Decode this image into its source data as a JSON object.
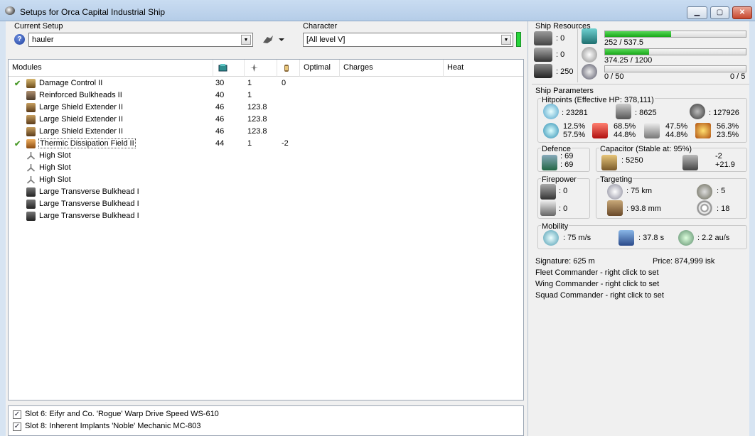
{
  "window": {
    "title": "Setups for Orca Capital Industrial Ship"
  },
  "setup": {
    "label": "Current Setup",
    "value": "hauler"
  },
  "character": {
    "label": "Character",
    "value": "[All level V]"
  },
  "modules_table": {
    "columns": {
      "modules": "Modules",
      "optimal": "Optimal",
      "charges": "Charges",
      "heat": "Heat"
    },
    "rows": [
      {
        "checked": true,
        "name": "Damage Control II",
        "cpu": "30",
        "pg": "1",
        "cap": "0"
      },
      {
        "checked": false,
        "name": "Reinforced Bulkheads II",
        "cpu": "40",
        "pg": "1",
        "cap": ""
      },
      {
        "checked": false,
        "name": "Large Shield Extender II",
        "cpu": "46",
        "pg": "123.8",
        "cap": ""
      },
      {
        "checked": false,
        "name": "Large Shield Extender II",
        "cpu": "46",
        "pg": "123.8",
        "cap": ""
      },
      {
        "checked": false,
        "name": "Large Shield Extender II",
        "cpu": "46",
        "pg": "123.8",
        "cap": ""
      },
      {
        "checked": true,
        "name": "Thermic Dissipation Field II",
        "cpu": "44",
        "pg": "1",
        "cap": "-2"
      },
      {
        "checked": false,
        "name": "High Slot",
        "cpu": "",
        "pg": "",
        "cap": ""
      },
      {
        "checked": false,
        "name": "High Slot",
        "cpu": "",
        "pg": "",
        "cap": ""
      },
      {
        "checked": false,
        "name": "High Slot",
        "cpu": "",
        "pg": "",
        "cap": ""
      },
      {
        "checked": false,
        "name": "Large Transverse Bulkhead I",
        "cpu": "",
        "pg": "",
        "cap": ""
      },
      {
        "checked": false,
        "name": "Large Transverse Bulkhead I",
        "cpu": "",
        "pg": "",
        "cap": ""
      },
      {
        "checked": false,
        "name": "Large Transverse Bulkhead I",
        "cpu": "",
        "pg": "",
        "cap": ""
      }
    ]
  },
  "implants": [
    {
      "checked": true,
      "label": "Slot 6: Eifyr and Co. 'Rogue' Warp Drive Speed WS-610"
    },
    {
      "checked": true,
      "label": "Slot 8: Inherent Implants 'Noble' Mechanic MC-803"
    }
  ],
  "resources": {
    "title": "Ship Resources",
    "turrets": ": 0",
    "launchers": ": 0",
    "drone_bay": ": 250",
    "cpu": {
      "text": "252 / 537.5",
      "fraction": 0.469
    },
    "powergrid": {
      "text": "374.25 / 1200",
      "fraction": 0.312
    },
    "drone_bw": {
      "text": "0 / 50",
      "fraction": 0.0,
      "slots": "0 / 5"
    }
  },
  "params": {
    "title": "Ship Parameters",
    "hitpoints": {
      "title": "Hitpoints (Effective HP: 378,111)",
      "shield": ": 23281",
      "armor": ": 8625",
      "structure": ": 127926",
      "em": {
        "a": "12.5%",
        "b": "57.5%"
      },
      "thermal": {
        "a": "68.5%",
        "b": "44.8%"
      },
      "kinetic": {
        "a": "47.5%",
        "b": "44.8%"
      },
      "explosive": {
        "a": "56.3%",
        "b": "23.5%"
      }
    },
    "defence": {
      "title": "Defence",
      "a": ": 69",
      "b": ": 69"
    },
    "capacitor": {
      "title": "Capacitor (Stable at: 95%)",
      "amount": ": 5250",
      "use": "-2",
      "recharge": "+21.9"
    },
    "firepower": {
      "title": "Firepower",
      "a": ": 0",
      "b": ": 0"
    },
    "targeting": {
      "title": "Targeting",
      "range": ": 75 km",
      "targets": ": 5",
      "resolution": ": 93.8 mm",
      "sensor": ": 18"
    },
    "mobility": {
      "title": "Mobility",
      "speed": ": 75 m/s",
      "align": ": 37.8 s",
      "warp": ": 2.2 au/s"
    },
    "signature": "Signature: 625 m",
    "price": "Price: 874,999 isk",
    "fleet": "Fleet Commander - right click to set",
    "wing": "Wing Commander - right click to set",
    "squad": "Squad Commander - right click to set"
  }
}
